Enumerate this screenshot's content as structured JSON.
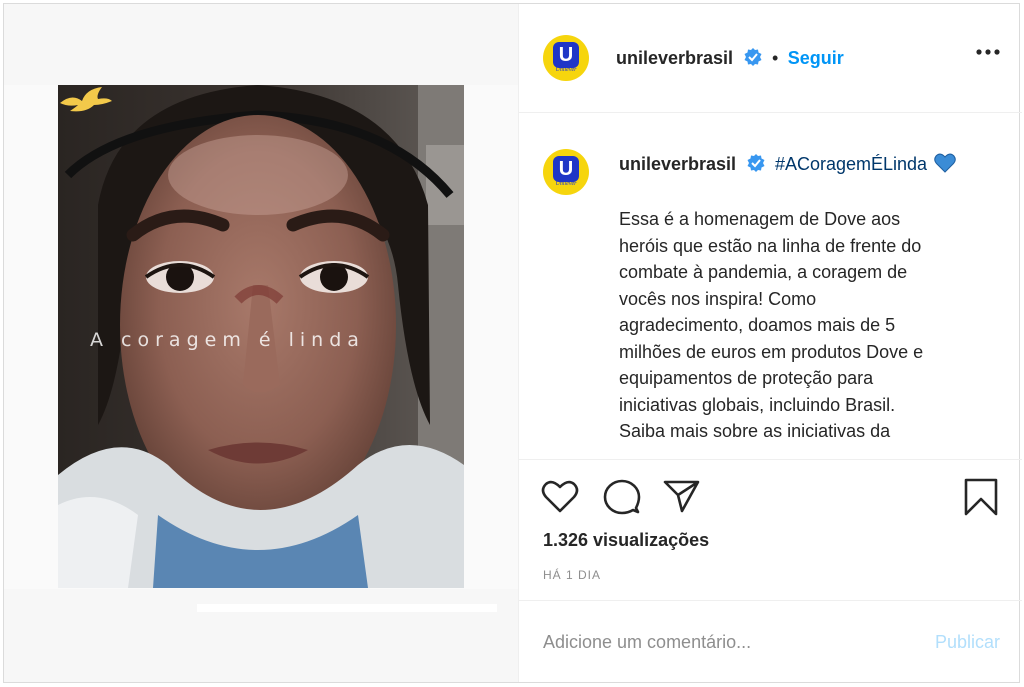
{
  "post": {
    "username": "unileverbrasil",
    "avatar_letter": "U",
    "avatar_sub": "Unilever",
    "follow_label": "Seguir",
    "separator": "•",
    "hashtag": "#ACoragemÉLinda",
    "caption_lines": [
      "Essa é a homenagem de Dove aos",
      "heróis que estão na linha de frente do",
      "combate à pandemia, a coragem de",
      "vocês nos inspira! Como",
      "agradecimento, doamos mais de 5",
      "milhões de euros em produtos Dove e",
      "equipamentos de proteção para",
      "iniciativas globais, incluindo Brasil.",
      "Saiba mais sobre as iniciativas da"
    ],
    "views": "1.326 visualizações",
    "time": "HÁ 1 DIA"
  },
  "media": {
    "overlay_text": "A coragem é linda"
  },
  "comment": {
    "placeholder": "Adicione um comentário...",
    "publish_label": "Publicar"
  },
  "colors": {
    "link_blue": "#0095f6",
    "verified_blue": "#3897f0",
    "avatar_yellow": "#f6d50d",
    "unilever_blue": "#1f36c7",
    "publish_disabled": "#b2dffc",
    "hashtag_heart": "#3b8cd6"
  },
  "icons": {
    "like": "heart-icon",
    "comment": "comment-icon",
    "share": "share-icon",
    "save": "bookmark-icon",
    "more": "more-options-icon",
    "verified": "verified-badge-icon",
    "dove": "dove-icon"
  }
}
